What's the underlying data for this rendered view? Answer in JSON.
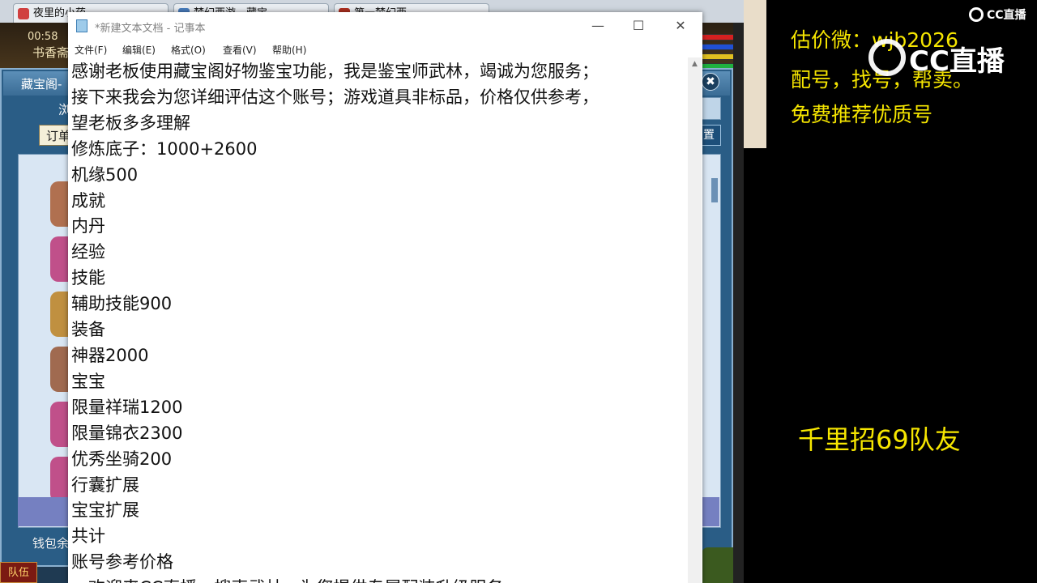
{
  "browser": {
    "tabs": [
      {
        "label": "夜里的小药",
        "icon_color": "#d04040"
      },
      {
        "label": "梦幻西游 - 藏宝",
        "icon_color": "#4a7fc0"
      },
      {
        "label": "第一梦幻西",
        "icon_color": "#b03020"
      }
    ]
  },
  "game": {
    "time": "00:58",
    "location": "书香斋",
    "panel_title": "藏宝阁-",
    "panel_subtitle": "浏",
    "close_symbol": "✖",
    "order_tab": "订单",
    "setting_tab": "置",
    "wallet_label": "钱包余",
    "team_button": "队伍"
  },
  "notepad": {
    "title": "*新建文本文档 - 记事本",
    "minimize": "—",
    "maximize": "☐",
    "close": "✕",
    "menu": [
      "文件(F)",
      "编辑(E)",
      "格式(O)",
      "查看(V)",
      "帮助(H)"
    ],
    "lines": [
      "感谢老板使用藏宝阁好物鉴宝功能，我是鉴宝师武林，竭诚为您服务；",
      "接下来我会为您详细评估这个账号；游戏道具非标品，价格仅供参考，",
      "望老板多多理解",
      "修炼底子：1000+2600",
      "机缘500",
      "成就",
      "内丹",
      "经验",
      "技能",
      "辅助技能900",
      "装备",
      "神器2000",
      "宝宝",
      "限量祥瑞1200",
      "限量锦衣2300",
      "优秀坐骑200",
      "行囊扩展",
      "宝宝扩展",
      "共计",
      "账号参考价格",
      "，欢迎来CC直播，搜索武林，为您提供专属配装升级服务"
    ]
  },
  "overlay": {
    "line1": "估价微：wjb2026",
    "line2": "配号，找号，帮卖。",
    "line3": "免费推荐优质号",
    "recruit": "千里招69队友",
    "cc_logo_small": "CC直播",
    "cc_logo_big": "CC直播",
    "text_color": "#f6e600"
  }
}
